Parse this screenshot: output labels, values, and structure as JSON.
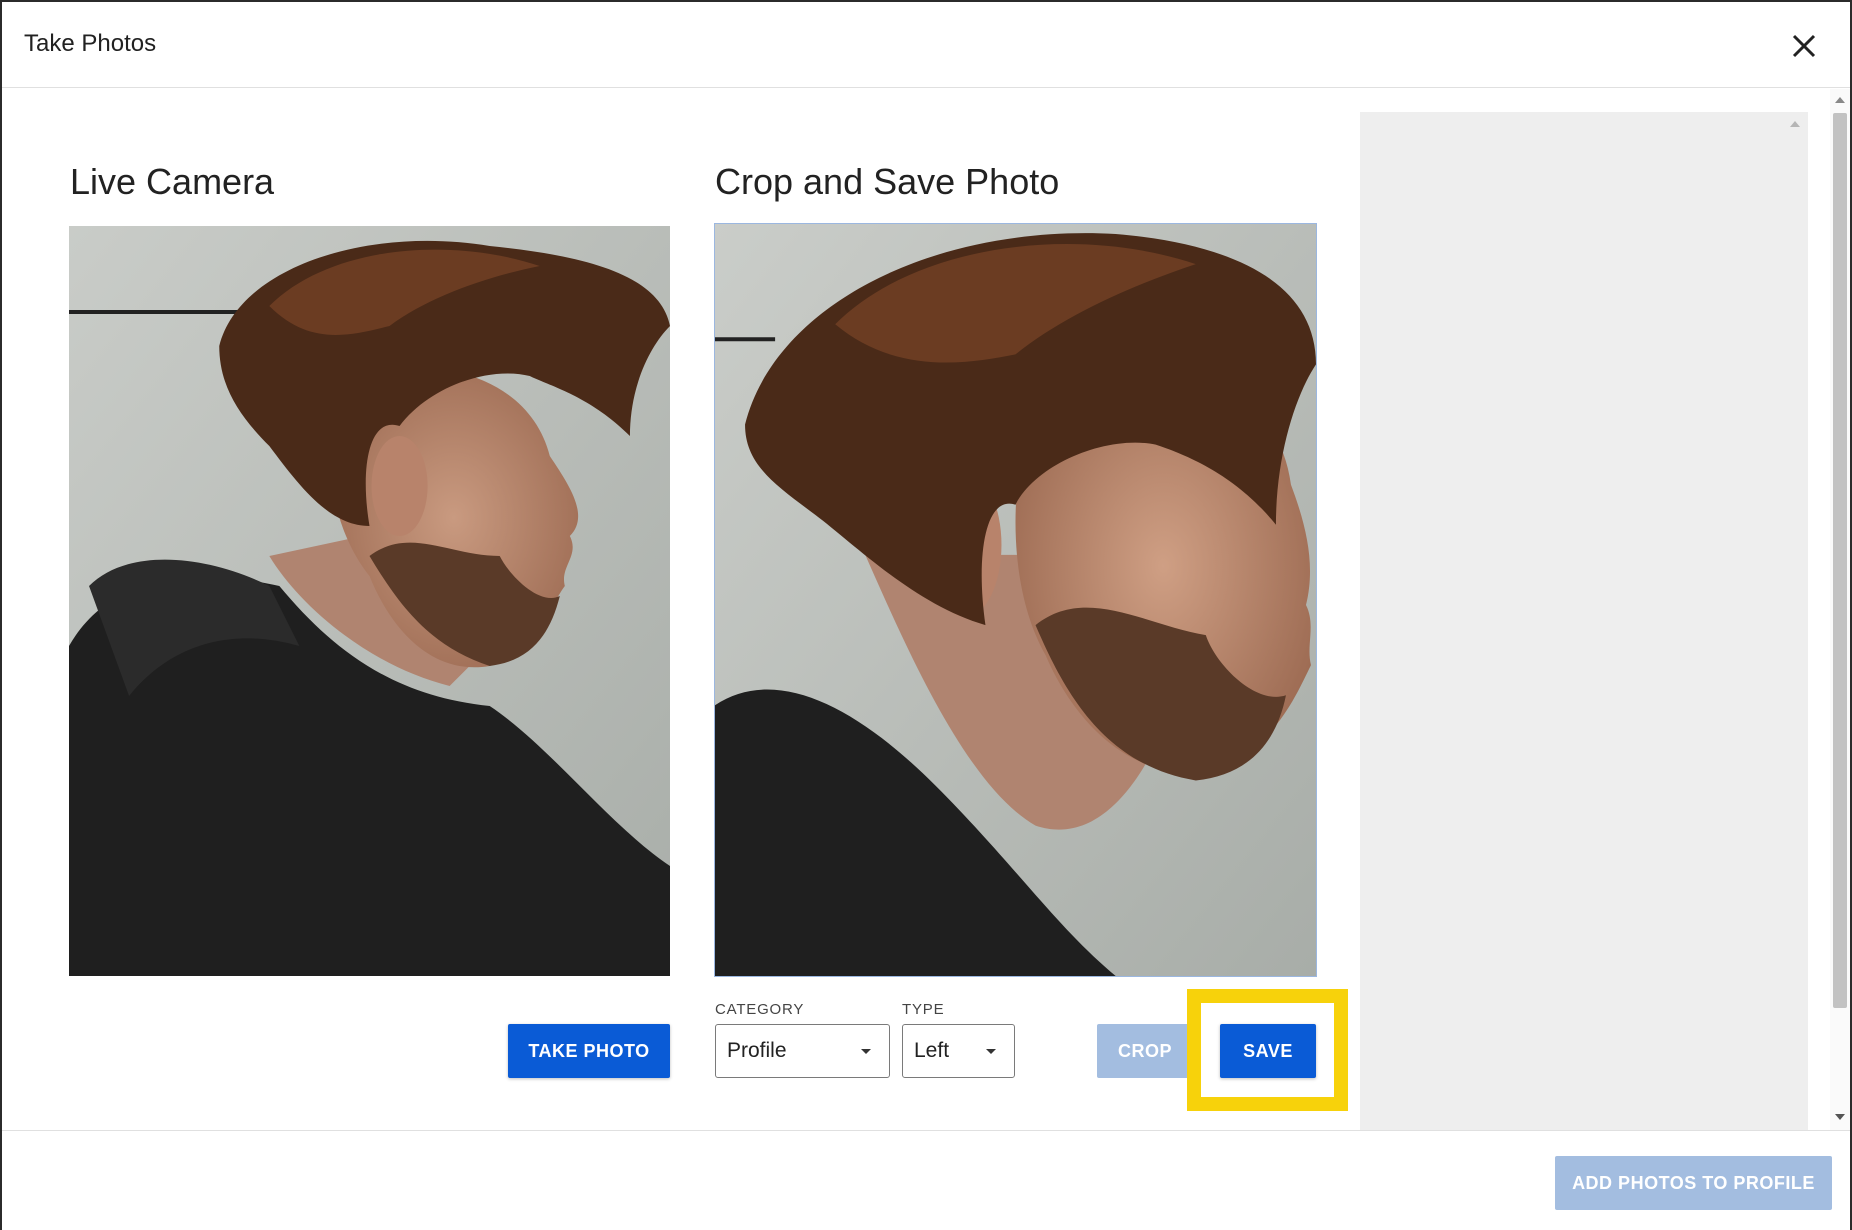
{
  "dialog": {
    "title": "Take Photos",
    "close_icon": "close-icon"
  },
  "live_camera": {
    "title": "Live Camera",
    "take_photo_label": "TAKE PHOTO"
  },
  "crop_panel": {
    "title": "Crop and Save Photo",
    "category_label": "CATEGORY",
    "category_value": "Profile",
    "type_label": "TYPE",
    "type_value": "Left",
    "crop_label": "CROP",
    "save_label": "SAVE"
  },
  "footer": {
    "add_photos_label": "ADD PHOTOS TO PROFILE"
  },
  "colors": {
    "primary": "#0a5bd6",
    "disabled": "#a3bde0",
    "highlight": "#f7d20b",
    "side_panel": "#eeeeee"
  }
}
